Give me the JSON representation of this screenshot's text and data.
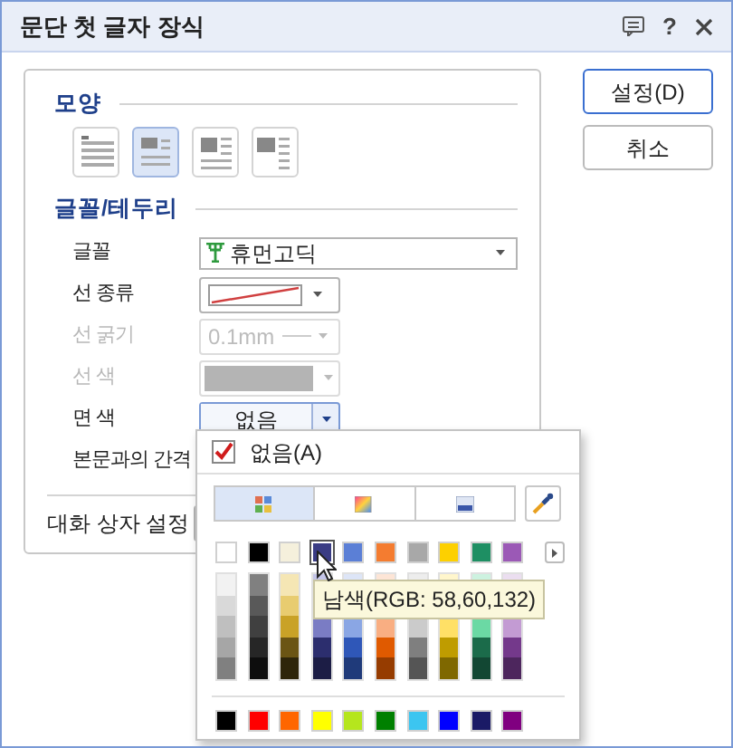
{
  "window": {
    "title": "문단 첫 글자 장식",
    "help_button": "?"
  },
  "shape": {
    "heading": "모양",
    "options": [
      {
        "kind": "none",
        "selected": false
      },
      {
        "kind": "drop",
        "selected": true
      },
      {
        "kind": "margin",
        "selected": false
      },
      {
        "kind": "outside",
        "selected": false
      }
    ]
  },
  "border": {
    "heading": "글꼴/테두리",
    "rows": [
      {
        "label": "글꼴",
        "kind": "font",
        "value": "휴먼고딕",
        "disabled": false
      },
      {
        "label": "선 종류",
        "kind": "line",
        "disabled": false
      },
      {
        "label": "선 굵기",
        "kind": "thickness",
        "value": "0.1mm",
        "disabled": true
      },
      {
        "label": "선 색",
        "kind": "color",
        "disabled": true
      },
      {
        "label": "면 색",
        "kind": "fill",
        "value": "없음",
        "disabled": false,
        "expanded": true
      },
      {
        "label": "본문과의 간격",
        "kind": "spacing",
        "disabled": false
      }
    ]
  },
  "dialog_settings": {
    "label": "대화 상자 설정"
  },
  "buttons": [
    {
      "label": "설정(D)",
      "default": true
    },
    {
      "label": "취소",
      "default": false
    }
  ],
  "color_popup": {
    "none_option": {
      "label": "없음(A)",
      "checked": true
    },
    "tabs": [
      {
        "kind": "palette",
        "selected": true
      },
      {
        "kind": "spectrum",
        "selected": false
      },
      {
        "kind": "image",
        "selected": false
      }
    ],
    "theme_colors": [
      {
        "color": "#ffffff",
        "selected": false
      },
      {
        "color": "#000000",
        "selected": false
      },
      {
        "color": "#f5f0dc",
        "selected": false
      },
      {
        "color": "#3a3c84",
        "selected": true
      },
      {
        "color": "#5b7fd6",
        "selected": false
      },
      {
        "color": "#f47c30",
        "selected": false
      },
      {
        "color": "#a8a8a8",
        "selected": false
      },
      {
        "color": "#fdd000",
        "selected": false
      },
      {
        "color": "#1e8f63",
        "selected": false
      },
      {
        "color": "#9b59b6",
        "selected": false
      }
    ],
    "shade_columns": [
      {
        "shades": [
          {
            "color": "#f2f2f2"
          },
          {
            "color": "#d9d9d9"
          },
          {
            "color": "#bfbfbf"
          },
          {
            "color": "#a6a6a6"
          },
          {
            "color": "#808080"
          }
        ]
      },
      {
        "shades": [
          {
            "color": "#808080"
          },
          {
            "color": "#595959"
          },
          {
            "color": "#404040"
          },
          {
            "color": "#262626"
          },
          {
            "color": "#0d0d0d"
          }
        ]
      },
      {
        "shades": [
          {
            "color": "#f5e6b4"
          },
          {
            "color": "#e8cc70"
          },
          {
            "color": "#c9a227"
          },
          {
            "color": "#6b5514"
          },
          {
            "color": "#2e250a"
          }
        ]
      },
      {
        "shades": [
          {
            "color": "#c4c5e8"
          }
        ],
        "lower_shades": [
          {
            "color": "#7a7cc4"
          },
          {
            "color": "#2c2e6e"
          },
          {
            "color": "#1c1d45"
          }
        ]
      },
      {
        "shades": [
          {
            "color": "#dde5f7"
          }
        ],
        "lower_shades": [
          {
            "color": "#8aa6e4"
          },
          {
            "color": "#2f57b8"
          },
          {
            "color": "#1f3a7a"
          }
        ]
      },
      {
        "shades": [
          {
            "color": "#fde5d6"
          }
        ],
        "lower_shades": [
          {
            "color": "#f9ae82"
          },
          {
            "color": "#e05a00"
          },
          {
            "color": "#963c00"
          }
        ]
      },
      {
        "shades": [
          {
            "color": "#ededed"
          }
        ],
        "lower_shades": [
          {
            "color": "#cbcbcb"
          },
          {
            "color": "#7f7f7f"
          },
          {
            "color": "#555555"
          }
        ]
      },
      {
        "shades": [
          {
            "color": "#fff6cc"
          }
        ],
        "lower_shades": [
          {
            "color": "#ffe066"
          },
          {
            "color": "#bf9c00"
          },
          {
            "color": "#7f6800"
          }
        ]
      },
      {
        "shades": [
          {
            "color": "#cdf2e0"
          }
        ],
        "lower_shades": [
          {
            "color": "#6bd9a4"
          },
          {
            "color": "#1b6b4a"
          },
          {
            "color": "#124733"
          }
        ]
      },
      {
        "shades": [
          {
            "color": "#ebdef0"
          }
        ],
        "lower_shades": [
          {
            "color": "#c39bd3"
          },
          {
            "color": "#74398b"
          },
          {
            "color": "#4d265d"
          }
        ]
      }
    ],
    "standard_colors": [
      {
        "color": "#000000"
      },
      {
        "color": "#ff0000"
      },
      {
        "color": "#ff6600"
      },
      {
        "color": "#ffff00"
      },
      {
        "color": "#b5e61d"
      },
      {
        "color": "#008000"
      },
      {
        "color": "#3cc5f0"
      },
      {
        "color": "#0000ff"
      },
      {
        "color": "#1a1a66"
      },
      {
        "color": "#800080"
      }
    ],
    "tooltip": "남색(RGB: 58,60,132)"
  }
}
